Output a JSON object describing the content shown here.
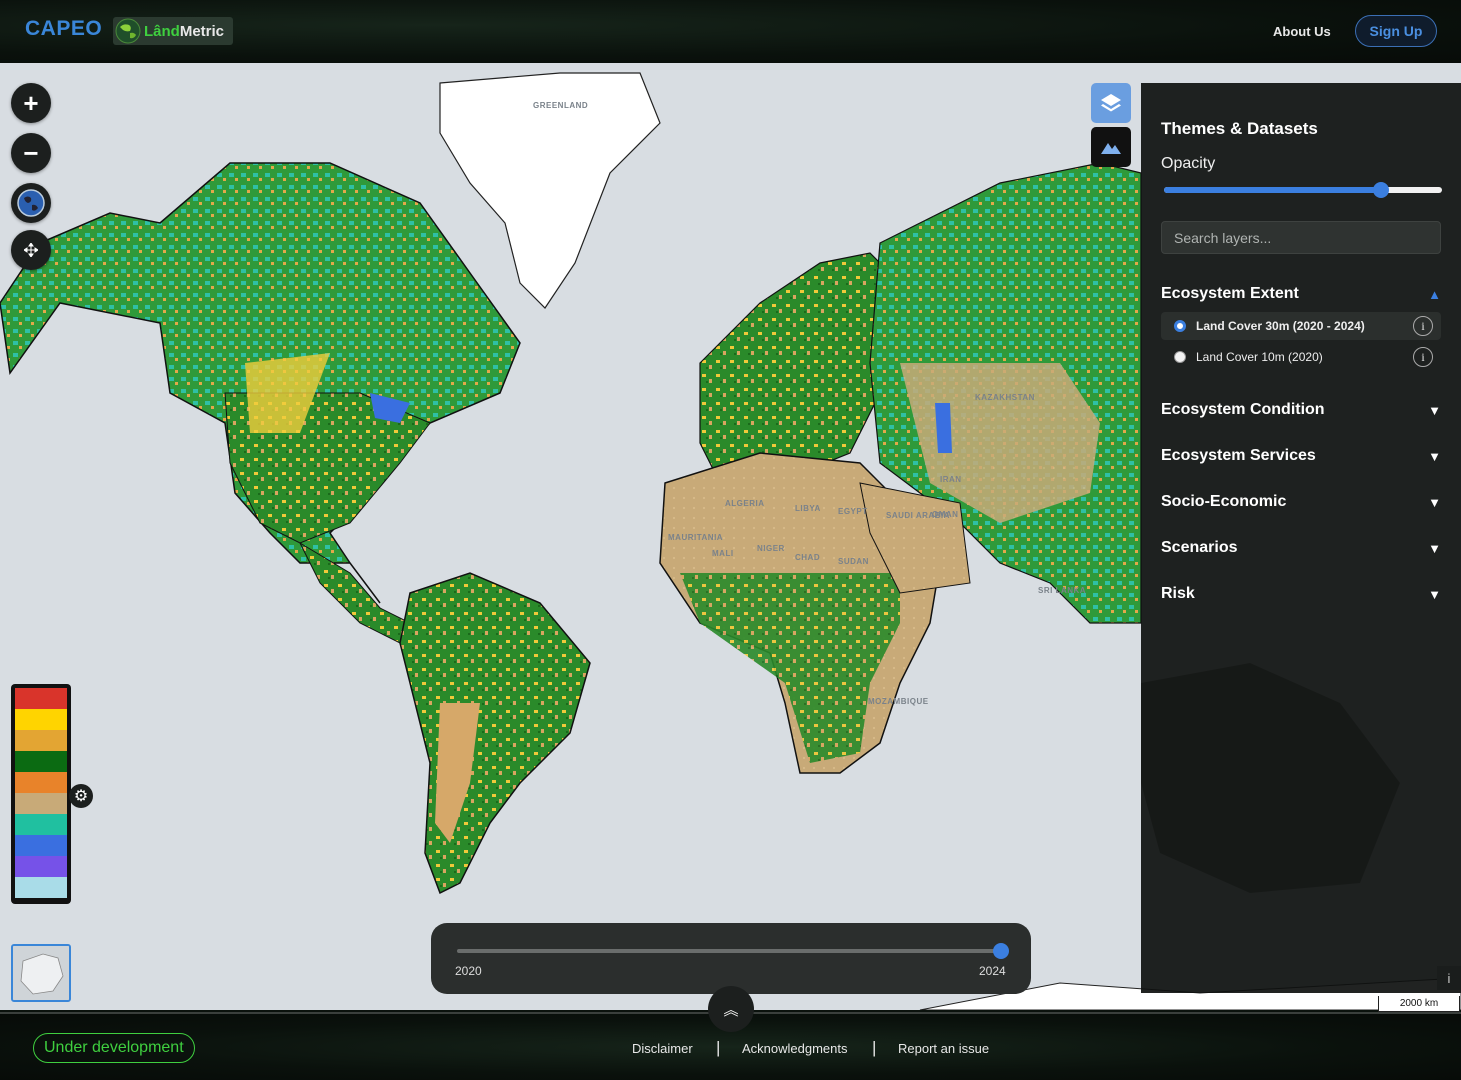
{
  "header": {
    "brand": "CAPEO",
    "logo_text_a": "Lând",
    "logo_text_b": "Metric",
    "about_label": "About Us",
    "signup_label": "Sign Up"
  },
  "map": {
    "labels": [
      "GREENLAND",
      "KAZAKHSTAN",
      "LIBYA",
      "ALGERIA",
      "NIGER",
      "CHAD",
      "SUDAN",
      "MAURITANIA",
      "MALI",
      "EGYPT",
      "SAUDI ARABIA",
      "IRAN",
      "OMAN",
      "SRI LANKA",
      "MOZAMBIQUE"
    ],
    "controls": {
      "zoom_in": "+",
      "zoom_out": "−",
      "pan_icon": "move-icon",
      "globe_icon": "globe-icon"
    },
    "scale_label": "2000 km",
    "attribution_label": "i"
  },
  "legend": {
    "colors": [
      "#d9342b",
      "#ffd400",
      "#e3a533",
      "#0b6b12",
      "#e8832a",
      "#c8aa78",
      "#20c0a0",
      "#3a6fe0",
      "#7652e8",
      "#a9dce8"
    ]
  },
  "panel": {
    "title": "Themes & Datasets",
    "opacity_label": "Opacity",
    "opacity_value": 0.78,
    "search_placeholder": "Search layers...",
    "sections": [
      {
        "title": "Ecosystem Extent",
        "expanded": true
      },
      {
        "title": "Ecosystem Condition",
        "expanded": false
      },
      {
        "title": "Ecosystem Services",
        "expanded": false
      },
      {
        "title": "Socio-Economic",
        "expanded": false
      },
      {
        "title": "Scenarios",
        "expanded": false
      },
      {
        "title": "Risk",
        "expanded": false
      }
    ],
    "layers": [
      {
        "label": "Land Cover 30m (2020 - 2024)",
        "selected": true
      },
      {
        "label": "Land Cover 10m (2020)",
        "selected": false
      }
    ],
    "arrow_up": "▲",
    "arrow_down": "▼",
    "info_label": "i"
  },
  "timeline": {
    "start": "2020",
    "end": "2024",
    "value": "2024",
    "expand_icon": "chevron-double-up-icon"
  },
  "footer": {
    "status": "Under development",
    "links": [
      "Disclaimer",
      "Acknowledgments",
      "Report an issue"
    ],
    "separator": "|"
  }
}
